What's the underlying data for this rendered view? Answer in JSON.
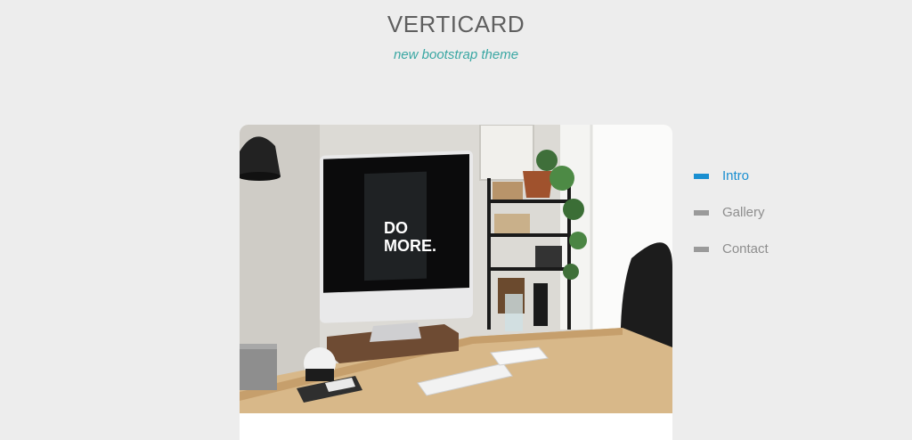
{
  "header": {
    "title": "VERTICARD",
    "tagline": "new bootstrap theme"
  },
  "hero": {
    "screen_text_line1": "DO",
    "screen_text_line2": "MORE."
  },
  "nav": {
    "items": [
      {
        "label": "Intro",
        "active": true
      },
      {
        "label": "Gallery",
        "active": false
      },
      {
        "label": "Contact",
        "active": false
      }
    ]
  },
  "colors": {
    "background": "#ededed",
    "title": "#5f5f5f",
    "tagline": "#3aa7a3",
    "nav_active": "#1a8fd1",
    "nav_inactive": "#8e8e8e",
    "marker_inactive": "#9a9a9a"
  }
}
